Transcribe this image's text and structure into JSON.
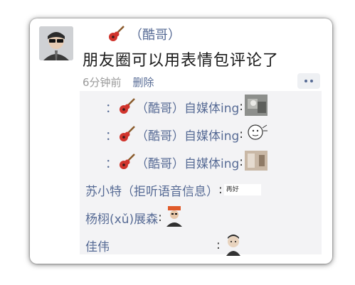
{
  "post": {
    "username_prefix": "·",
    "username": "（酷哥）",
    "text": "朋友圈可以用表情包评论了",
    "time": "6分钟前",
    "delete_label": "删除"
  },
  "comments": [
    {
      "prefix": "：",
      "name": "（酷哥）自媒体ing",
      "colon": ":",
      "sticker": "photo-sticker"
    },
    {
      "prefix": "：",
      "name": "（酷哥）自媒体ing",
      "colon": ":",
      "sticker": "doodle-face-sticker"
    },
    {
      "prefix": "：",
      "name": "（酷哥）自媒体ing",
      "colon": ":",
      "sticker": "photo-sticker"
    },
    {
      "name": "苏小特（拒听语音信息）",
      "colon": ":",
      "sticker": "text-sticker",
      "sticker_text": "再好"
    },
    {
      "name": "杨栩(xǔ)展森",
      "colon": ":",
      "sticker": "person-sticker"
    },
    {
      "name": "佳伟",
      "colon": ":",
      "sticker": "cartoon-sticker"
    }
  ],
  "colors": {
    "link": "#576b95",
    "comment_bg": "#f3f3f5",
    "time": "#9a9a9a"
  }
}
